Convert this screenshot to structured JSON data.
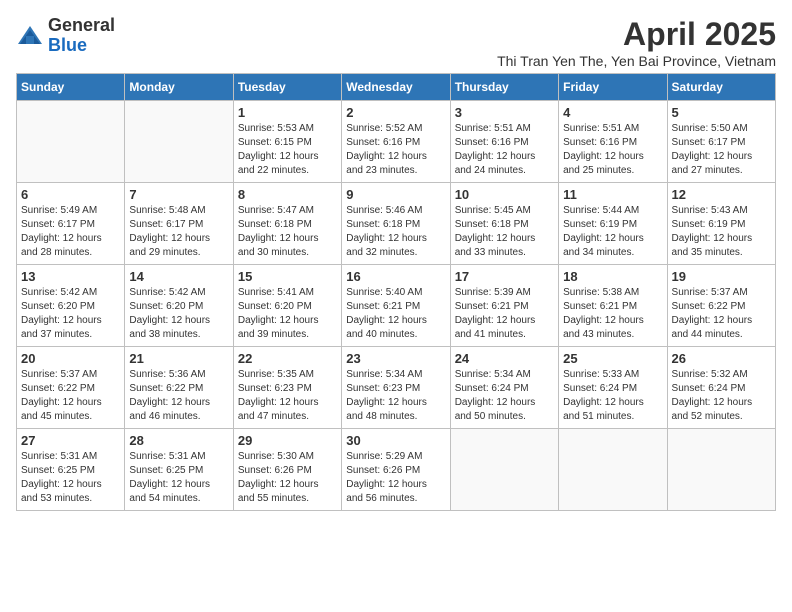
{
  "logo": {
    "general": "General",
    "blue": "Blue"
  },
  "header": {
    "title": "April 2025",
    "subtitle": "Thi Tran Yen The, Yen Bai Province, Vietnam"
  },
  "weekdays": [
    "Sunday",
    "Monday",
    "Tuesday",
    "Wednesday",
    "Thursday",
    "Friday",
    "Saturday"
  ],
  "weeks": [
    [
      {
        "day": "",
        "info": ""
      },
      {
        "day": "",
        "info": ""
      },
      {
        "day": "1",
        "info": "Sunrise: 5:53 AM\nSunset: 6:15 PM\nDaylight: 12 hours and 22 minutes."
      },
      {
        "day": "2",
        "info": "Sunrise: 5:52 AM\nSunset: 6:16 PM\nDaylight: 12 hours and 23 minutes."
      },
      {
        "day": "3",
        "info": "Sunrise: 5:51 AM\nSunset: 6:16 PM\nDaylight: 12 hours and 24 minutes."
      },
      {
        "day": "4",
        "info": "Sunrise: 5:51 AM\nSunset: 6:16 PM\nDaylight: 12 hours and 25 minutes."
      },
      {
        "day": "5",
        "info": "Sunrise: 5:50 AM\nSunset: 6:17 PM\nDaylight: 12 hours and 27 minutes."
      }
    ],
    [
      {
        "day": "6",
        "info": "Sunrise: 5:49 AM\nSunset: 6:17 PM\nDaylight: 12 hours and 28 minutes."
      },
      {
        "day": "7",
        "info": "Sunrise: 5:48 AM\nSunset: 6:17 PM\nDaylight: 12 hours and 29 minutes."
      },
      {
        "day": "8",
        "info": "Sunrise: 5:47 AM\nSunset: 6:18 PM\nDaylight: 12 hours and 30 minutes."
      },
      {
        "day": "9",
        "info": "Sunrise: 5:46 AM\nSunset: 6:18 PM\nDaylight: 12 hours and 32 minutes."
      },
      {
        "day": "10",
        "info": "Sunrise: 5:45 AM\nSunset: 6:18 PM\nDaylight: 12 hours and 33 minutes."
      },
      {
        "day": "11",
        "info": "Sunrise: 5:44 AM\nSunset: 6:19 PM\nDaylight: 12 hours and 34 minutes."
      },
      {
        "day": "12",
        "info": "Sunrise: 5:43 AM\nSunset: 6:19 PM\nDaylight: 12 hours and 35 minutes."
      }
    ],
    [
      {
        "day": "13",
        "info": "Sunrise: 5:42 AM\nSunset: 6:20 PM\nDaylight: 12 hours and 37 minutes."
      },
      {
        "day": "14",
        "info": "Sunrise: 5:42 AM\nSunset: 6:20 PM\nDaylight: 12 hours and 38 minutes."
      },
      {
        "day": "15",
        "info": "Sunrise: 5:41 AM\nSunset: 6:20 PM\nDaylight: 12 hours and 39 minutes."
      },
      {
        "day": "16",
        "info": "Sunrise: 5:40 AM\nSunset: 6:21 PM\nDaylight: 12 hours and 40 minutes."
      },
      {
        "day": "17",
        "info": "Sunrise: 5:39 AM\nSunset: 6:21 PM\nDaylight: 12 hours and 41 minutes."
      },
      {
        "day": "18",
        "info": "Sunrise: 5:38 AM\nSunset: 6:21 PM\nDaylight: 12 hours and 43 minutes."
      },
      {
        "day": "19",
        "info": "Sunrise: 5:37 AM\nSunset: 6:22 PM\nDaylight: 12 hours and 44 minutes."
      }
    ],
    [
      {
        "day": "20",
        "info": "Sunrise: 5:37 AM\nSunset: 6:22 PM\nDaylight: 12 hours and 45 minutes."
      },
      {
        "day": "21",
        "info": "Sunrise: 5:36 AM\nSunset: 6:22 PM\nDaylight: 12 hours and 46 minutes."
      },
      {
        "day": "22",
        "info": "Sunrise: 5:35 AM\nSunset: 6:23 PM\nDaylight: 12 hours and 47 minutes."
      },
      {
        "day": "23",
        "info": "Sunrise: 5:34 AM\nSunset: 6:23 PM\nDaylight: 12 hours and 48 minutes."
      },
      {
        "day": "24",
        "info": "Sunrise: 5:34 AM\nSunset: 6:24 PM\nDaylight: 12 hours and 50 minutes."
      },
      {
        "day": "25",
        "info": "Sunrise: 5:33 AM\nSunset: 6:24 PM\nDaylight: 12 hours and 51 minutes."
      },
      {
        "day": "26",
        "info": "Sunrise: 5:32 AM\nSunset: 6:24 PM\nDaylight: 12 hours and 52 minutes."
      }
    ],
    [
      {
        "day": "27",
        "info": "Sunrise: 5:31 AM\nSunset: 6:25 PM\nDaylight: 12 hours and 53 minutes."
      },
      {
        "day": "28",
        "info": "Sunrise: 5:31 AM\nSunset: 6:25 PM\nDaylight: 12 hours and 54 minutes."
      },
      {
        "day": "29",
        "info": "Sunrise: 5:30 AM\nSunset: 6:26 PM\nDaylight: 12 hours and 55 minutes."
      },
      {
        "day": "30",
        "info": "Sunrise: 5:29 AM\nSunset: 6:26 PM\nDaylight: 12 hours and 56 minutes."
      },
      {
        "day": "",
        "info": ""
      },
      {
        "day": "",
        "info": ""
      },
      {
        "day": "",
        "info": ""
      }
    ]
  ]
}
